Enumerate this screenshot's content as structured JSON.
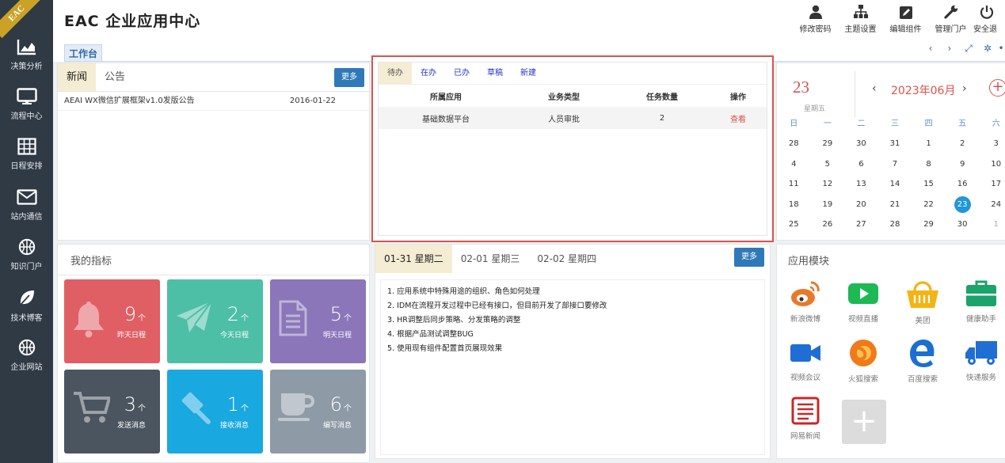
{
  "sidebar": {
    "logo": "EAC",
    "items": [
      {
        "label": "决策分析",
        "icon": "area-chart-icon"
      },
      {
        "label": "流程中心",
        "icon": "monitor-icon"
      },
      {
        "label": "日程安排",
        "icon": "calendar-grid-icon"
      },
      {
        "label": "站内通信",
        "icon": "envelope-icon"
      },
      {
        "label": "知识门户",
        "icon": "basketball-icon"
      },
      {
        "label": "技术博客",
        "icon": "leaf-icon"
      },
      {
        "label": "企业网站",
        "icon": "basketball-icon"
      }
    ]
  },
  "header": {
    "title": "EAC 企业应用中心",
    "actions": [
      {
        "label": "修改密码",
        "icon": "user-icon"
      },
      {
        "label": "主题设置",
        "icon": "sitemap-icon"
      },
      {
        "label": "编辑组件",
        "icon": "edit-icon"
      },
      {
        "label": "管理门户",
        "icon": "wrench-icon"
      },
      {
        "label": "安全退",
        "icon": "power-icon"
      }
    ],
    "workspace_tab": "工作台",
    "tools": [
      "‹",
      "›",
      "⤢",
      "✲",
      "•"
    ]
  },
  "news": {
    "tabs": [
      "新闻",
      "公告"
    ],
    "more_label": "更多",
    "items": [
      {
        "title": "AEAI WX微信扩展框架v1.0发版公告",
        "date": "2016-01-22"
      }
    ]
  },
  "tasks": {
    "tabs": [
      "待办",
      "在办",
      "已办",
      "草稿",
      "新建"
    ],
    "columns": [
      "所属应用",
      "业务类型",
      "任务数量",
      "操作"
    ],
    "rows": [
      {
        "app": "基础数据平台",
        "type": "人员审批",
        "count": "2",
        "action": "查看"
      }
    ]
  },
  "calendar": {
    "day": "23",
    "weekday": "星期五",
    "month_label": "2023年06月",
    "prev": "‹",
    "next": "›",
    "add": "+",
    "weekdays": [
      "日",
      "一",
      "二",
      "三",
      "四",
      "五",
      "六"
    ],
    "weeks": [
      [
        "28",
        "29",
        "30",
        "31",
        "1",
        "2",
        "3"
      ],
      [
        "4",
        "5",
        "6",
        "7",
        "8",
        "9",
        "10"
      ],
      [
        "11",
        "12",
        "13",
        "14",
        "15",
        "16",
        "17"
      ],
      [
        "18",
        "19",
        "20",
        "21",
        "22",
        "23",
        "24"
      ],
      [
        "25",
        "26",
        "27",
        "28",
        "29",
        "30",
        "1"
      ]
    ],
    "today": "23"
  },
  "indicators": {
    "title": "我的指标",
    "unit": "个",
    "items": [
      {
        "num": "9",
        "label": "昨天日程",
        "color": "#e05f64",
        "icon": "bell-icon"
      },
      {
        "num": "2",
        "label": "今天日程",
        "color": "#4dbfa7",
        "icon": "paper-plane-icon"
      },
      {
        "num": "5",
        "label": "明天日程",
        "color": "#8a76b8",
        "icon": "document-icon"
      },
      {
        "num": "3",
        "label": "发送消息",
        "color": "#4b555f",
        "icon": "cart-icon"
      },
      {
        "num": "1",
        "label": "接收消息",
        "color": "#19a8e0",
        "icon": "gavel-icon"
      },
      {
        "num": "6",
        "label": "编写消息",
        "color": "#8e9aa6",
        "icon": "cup-icon"
      }
    ]
  },
  "schedule": {
    "tabs": [
      "01-31 星期二",
      "02-01 星期三",
      "02-02 星期四"
    ],
    "more_label": "更多",
    "lines": [
      "1. 应用系统中特殊用途的组织、角色如何处理",
      "2. IDM在流程开发过程中已经有接口，但目前开发了部接口要修改",
      "3. HR调整后同步策略、分发策略的调整",
      "4. 根据产品测试调整BUG",
      "5. 使用现有组件配置首页展现效果"
    ]
  },
  "apps": {
    "title": "应用模块",
    "items": [
      {
        "label": "新浪微博",
        "icon": "weibo-icon"
      },
      {
        "label": "视频直播",
        "icon": "youtube-play-icon"
      },
      {
        "label": "美团",
        "icon": "basket-icon"
      },
      {
        "label": "健康助手",
        "icon": "medkit-icon"
      },
      {
        "label": "视频会议",
        "icon": "video-camera-icon"
      },
      {
        "label": "火狐搜索",
        "icon": "firefox-icon"
      },
      {
        "label": "百度搜索",
        "icon": "ie-icon"
      },
      {
        "label": "快递服务",
        "icon": "truck-icon"
      },
      {
        "label": "网易新闻",
        "icon": "newspaper-icon"
      }
    ],
    "add_label": "+"
  },
  "colors": {
    "accent": "#2f79b8",
    "danger": "#d9534f",
    "sidebar": "#2f3a45"
  }
}
